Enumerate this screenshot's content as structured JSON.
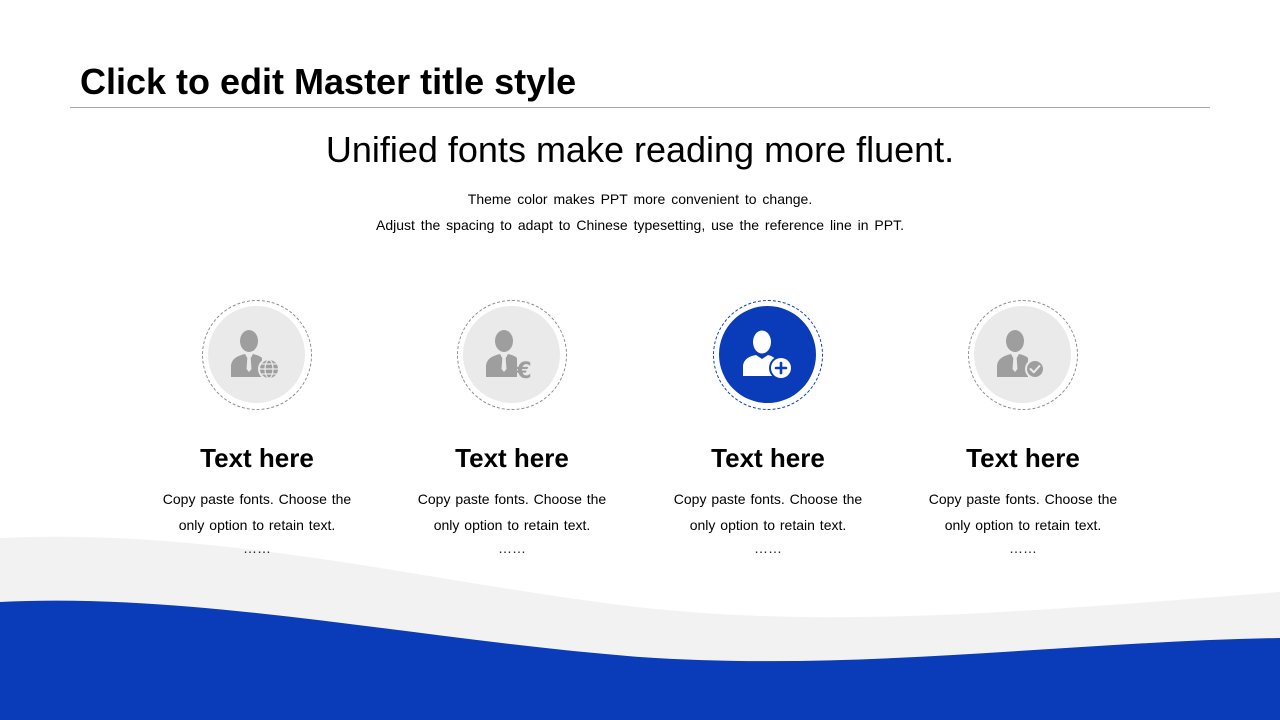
{
  "slide": {
    "master_title": "Click to edit Master title style",
    "headline": "Unified fonts make reading more fluent.",
    "subtitle_line1": "Theme color makes PPT more convenient to change.",
    "subtitle_line2": "Adjust the spacing to adapt to Chinese typesetting, use the reference line in PPT."
  },
  "cards": [
    {
      "icon": "businessman-globe-icon",
      "title": "Text here",
      "desc_line1": "Copy paste fonts. Choose the",
      "desc_line2": "only option to retain text.",
      "ellipsis": "……",
      "active": false
    },
    {
      "icon": "businessman-euro-icon",
      "title": "Text here",
      "desc_line1": "Copy paste fonts. Choose the",
      "desc_line2": "only option to retain text.",
      "ellipsis": "……",
      "active": false
    },
    {
      "icon": "user-add-icon",
      "title": "Text here",
      "desc_line1": "Copy paste fonts. Choose the",
      "desc_line2": "only option to retain text.",
      "ellipsis": "……",
      "active": true
    },
    {
      "icon": "businessman-check-icon",
      "title": "Text here",
      "desc_line1": "Copy paste fonts. Choose the",
      "desc_line2": "only option to retain text.",
      "ellipsis": "……",
      "active": false
    }
  ],
  "colors": {
    "accent": "#0a3bb8",
    "wave_light": "#f2f2f2",
    "icon_gray": "#9e9e9e",
    "circle_fill": "#eaeaea"
  }
}
